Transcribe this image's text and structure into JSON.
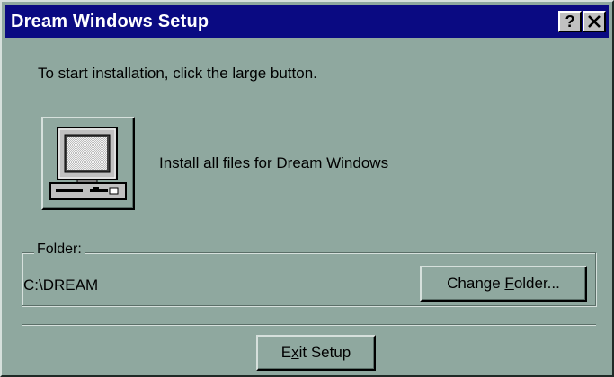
{
  "window": {
    "title": "Dream Windows Setup",
    "help_button": "?",
    "close_button": "✕"
  },
  "main": {
    "instruction": "To start installation, click the large button.",
    "install_label": "Install all files for Dream Windows"
  },
  "folder": {
    "legend": "Folder:",
    "path": "C:\\DREAM",
    "change_button": {
      "before": "Change ",
      "mnemonic": "F",
      "after": "older..."
    }
  },
  "footer": {
    "exit_button": {
      "before": "E",
      "mnemonic": "x",
      "after": "it Setup"
    }
  },
  "icons": {
    "install": "computer-icon"
  },
  "colors": {
    "title_bar": "#0a0a82",
    "dialog_face": "#8fa89f"
  }
}
